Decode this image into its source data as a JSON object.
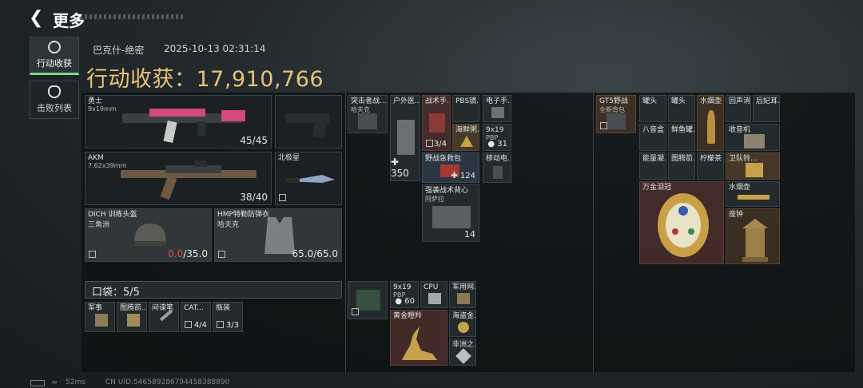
{
  "header": {
    "back_icon": "chevron-left-icon",
    "title": "更多"
  },
  "sidebar": {
    "tabs": [
      {
        "label": "行动收获",
        "icon": "loot-icon",
        "active": true
      },
      {
        "label": "击败列表",
        "icon": "skull-icon",
        "active": false
      }
    ]
  },
  "summary": {
    "map": "巴克什-绝密",
    "datetime": "2025-10-13 02:31:14",
    "headline_label": "行动收获：",
    "headline_value": "17,910,766"
  },
  "equipment": {
    "primary": {
      "name": "勇士",
      "ammo": "9x19mm",
      "count": "45/45"
    },
    "secondary": {
      "name": "AKM",
      "ammo": "7.62x39mm",
      "count": "38/40"
    },
    "pistol": {
      "name": ""
    },
    "knife": {
      "name": "北极星"
    },
    "helmet": {
      "name": "DICH 训练头盔",
      "sub": "三角洲",
      "durability": "0.0",
      "max": "/35.0"
    },
    "armor": {
      "name": "HMP特勤防弹衣",
      "sub": "哈夫克",
      "durability": "65.0/65.0"
    }
  },
  "pockets": {
    "label": "口袋：5/5",
    "items": [
      {
        "name": "军事"
      },
      {
        "name": "图腾箭..."
      },
      {
        "name": "间谍笔"
      },
      {
        "name": "CAT...",
        "count": "4/4"
      },
      {
        "name": "瓶装",
        "count": "3/3"
      }
    ]
  },
  "rig": {
    "items": [
      {
        "name": "突击者战...",
        "sub": "哈夫克"
      },
      {
        "name": "户外医...",
        "count": "350"
      },
      {
        "name": "战术手...",
        "count": "3/4"
      },
      {
        "name": "PBS镜..."
      },
      {
        "name": "海鲜粥..."
      },
      {
        "name": "电子手..."
      },
      {
        "name": "9x19",
        "sub": "PBP",
        "count": "31"
      },
      {
        "name": "野战急救包",
        "count": "124"
      },
      {
        "name": "移动电..."
      },
      {
        "name": "强袭战术背心",
        "sub": "阿萨拉",
        "count": "14"
      }
    ]
  },
  "backpack_left": {
    "items": [
      {
        "name": "9x19",
        "sub": "PBP",
        "count": "60"
      },
      {
        "name": "CPU"
      },
      {
        "name": "军用网..."
      },
      {
        "name": "黄金瞪羚"
      },
      {
        "name": "海盗金..."
      },
      {
        "name": "非洲之..."
      }
    ]
  },
  "backpack_right": {
    "bag": {
      "name": "GT5野战",
      "sub": "全新背包"
    },
    "items": [
      {
        "name": "罐头"
      },
      {
        "name": "罐头"
      },
      {
        "name": "水烟壶"
      },
      {
        "name": "回声消..."
      },
      {
        "name": "后妃耳..."
      },
      {
        "name": "八音盒"
      },
      {
        "name": "鲜鱼罐..."
      },
      {
        "name": "收音机"
      },
      {
        "name": "能量凝..."
      },
      {
        "name": "图腾箭..."
      },
      {
        "name": "柠檬茶"
      },
      {
        "name": "卫队铃..."
      },
      {
        "name": "万金泪冠"
      },
      {
        "name": "水烟壶"
      },
      {
        "name": "座钟"
      }
    ]
  },
  "footer": {
    "ping": "52ms",
    "uid": "CN UID:546589286794458388890"
  },
  "colors": {
    "accent": "#e7c27a",
    "active_tab": "#7fd58f",
    "danger": "#e44a4a"
  }
}
